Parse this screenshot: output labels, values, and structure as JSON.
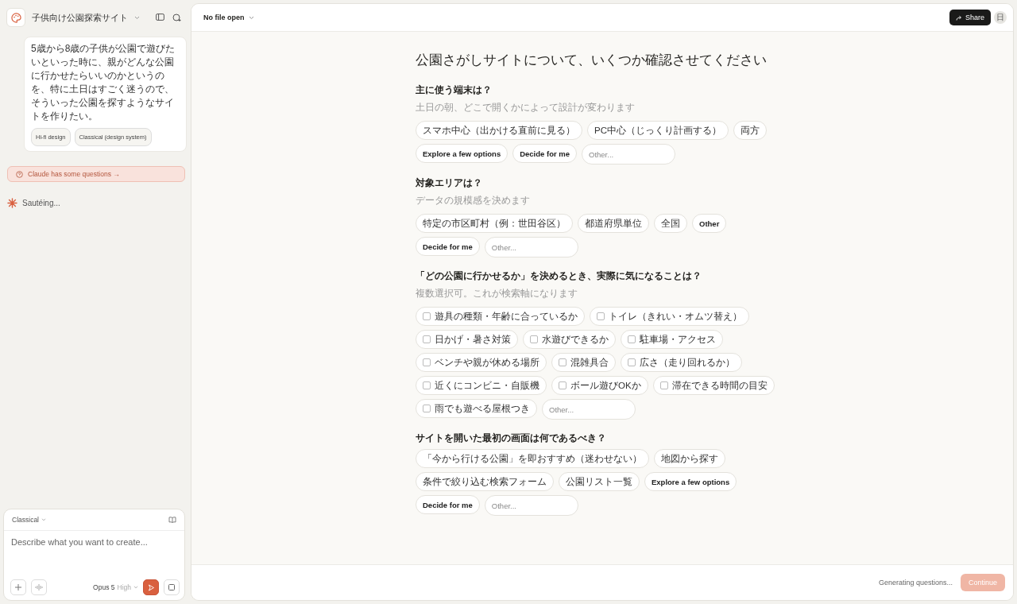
{
  "sidebar": {
    "project_title": "子供向け公園探索サイト",
    "message": {
      "text": "5歳から8歳の子供が公園で遊びたいといった時に、親がどんな公園に行かせたらいいのかというのを、特に土日はすごく迷うので、そういった公園を探すようなサイトを作りたい。",
      "tags": [
        "Hi-fi design",
        "Classical (design system)"
      ]
    },
    "notice": "Claude has some questions →",
    "status": "Sautéing...",
    "composer": {
      "style": "Classical",
      "placeholder": "Describe what you want to create...",
      "model": "Opus 5",
      "effort": "High"
    }
  },
  "topbar": {
    "file": "No file open",
    "share": "Share",
    "avatar": "日"
  },
  "form": {
    "title": "公園さがしサイトについて、いくつか確認させてください",
    "questions": [
      {
        "title": "主に使う端末は？",
        "hint": "土日の朝、どこで開くかによって設計が変わります",
        "options": [
          {
            "kind": "option",
            "label": "スマホ中心（出かける直前に見る）"
          },
          {
            "kind": "option",
            "label": "PC中心（じっくり計画する）"
          },
          {
            "kind": "option",
            "label": "両方"
          },
          {
            "kind": "meta",
            "label": "Explore a few options"
          },
          {
            "kind": "meta",
            "label": "Decide for me"
          },
          {
            "kind": "other",
            "placeholder": "Other..."
          }
        ]
      },
      {
        "title": "対象エリアは？",
        "hint": "データの規模感を決めます",
        "options": [
          {
            "kind": "option",
            "label": "特定の市区町村（例：世田谷区）"
          },
          {
            "kind": "option",
            "label": "都道府県単位"
          },
          {
            "kind": "option",
            "label": "全国"
          },
          {
            "kind": "meta",
            "label": "Other"
          },
          {
            "kind": "meta",
            "label": "Decide for me"
          },
          {
            "kind": "other",
            "placeholder": "Other..."
          }
        ]
      },
      {
        "title": "「どの公園に行かせるか」を決めるとき、実際に気になることは？",
        "hint": "複数選択可。これが検索軸になります",
        "options": [
          {
            "kind": "check",
            "label": "遊具の種類・年齢に合っているか",
            "checked": false
          },
          {
            "kind": "check",
            "label": "トイレ（きれい・オムツ替え）",
            "checked": false
          },
          {
            "kind": "check",
            "label": "日かげ・暑さ対策",
            "checked": false
          },
          {
            "kind": "check",
            "label": "水遊びできるか",
            "checked": false
          },
          {
            "kind": "check",
            "label": "駐車場・アクセス",
            "checked": false
          },
          {
            "kind": "check",
            "label": "ベンチや親が休める場所",
            "checked": false
          },
          {
            "kind": "check",
            "label": "混雑具合",
            "checked": false
          },
          {
            "kind": "check",
            "label": "広さ（走り回れるか）",
            "checked": false
          },
          {
            "kind": "check",
            "label": "近くにコンビニ・自販機",
            "checked": false
          },
          {
            "kind": "check",
            "label": "ボール遊びOKか",
            "checked": false
          },
          {
            "kind": "check",
            "label": "滞在できる時間の目安",
            "checked": false
          },
          {
            "kind": "check",
            "label": "雨でも遊べる屋根つき",
            "checked": false
          },
          {
            "kind": "other",
            "placeholder": "Other..."
          }
        ]
      },
      {
        "title": "サイトを開いた最初の画面は何であるべき？",
        "options": [
          {
            "kind": "option",
            "label": "「今から行ける公園」を即おすすめ（迷わせない）"
          },
          {
            "kind": "option",
            "label": "地図から探す"
          },
          {
            "kind": "option",
            "label": "条件で絞り込む検索フォーム"
          },
          {
            "kind": "option",
            "label": "公園リスト一覧"
          },
          {
            "kind": "meta",
            "label": "Explore a few options"
          },
          {
            "kind": "meta",
            "label": "Decide for me"
          },
          {
            "kind": "other",
            "placeholder": "Other..."
          }
        ]
      }
    ]
  },
  "footer": {
    "status": "Generating questions...",
    "continue": {
      "label": "Continue",
      "disabled": true
    }
  }
}
